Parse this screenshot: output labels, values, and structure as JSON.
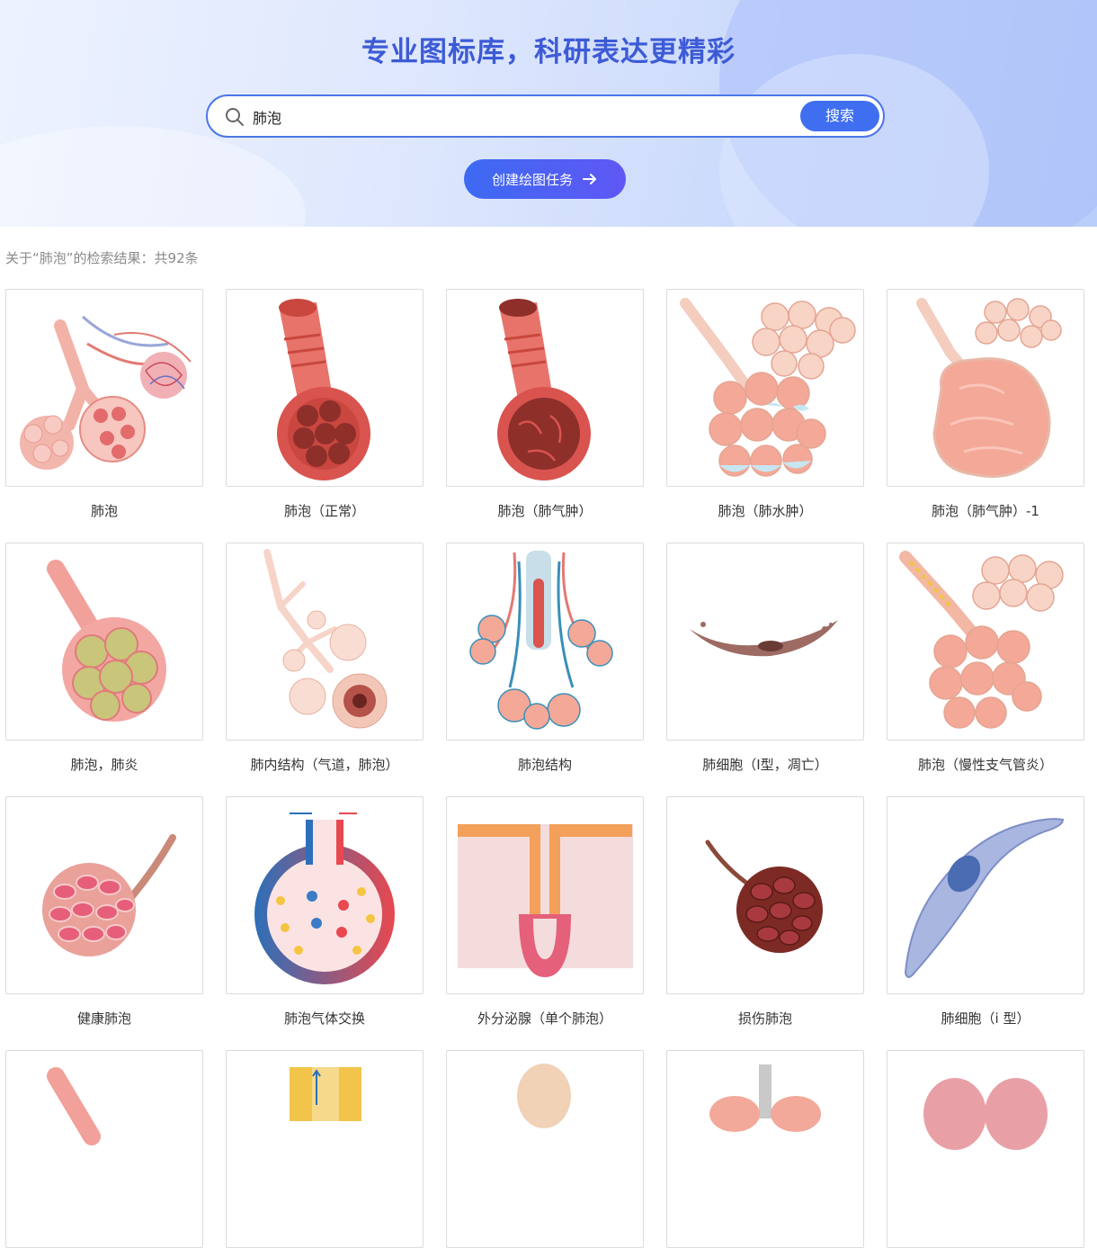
{
  "hero": {
    "title": "专业图标库，科研表达更精彩",
    "search": {
      "value": "肺泡",
      "button_label": "搜索"
    },
    "create_button": "创建绘图任务"
  },
  "results": {
    "summary": "关于“肺泡”的检索结果：共92条",
    "items": [
      {
        "label": "肺泡",
        "icon": "alveoli-branch-icon"
      },
      {
        "label": "肺泡（正常）",
        "icon": "alveolus-normal-icon"
      },
      {
        "label": "肺泡（肺气肿）",
        "icon": "alveolus-emphysema-icon"
      },
      {
        "label": "肺泡（肺水肿）",
        "icon": "alveolus-edema-icon"
      },
      {
        "label": "肺泡（肺气肿）-1",
        "icon": "alveolus-emphysema-1-icon"
      },
      {
        "label": "肺泡，肺炎",
        "icon": "alveolus-pneumonia-icon"
      },
      {
        "label": "肺内结构（气道，肺泡）",
        "icon": "lung-airway-structure-icon"
      },
      {
        "label": "肺泡结构",
        "icon": "alveolar-structure-icon"
      },
      {
        "label": "肺细胞（I型，凋亡）",
        "icon": "type1-cell-apoptosis-icon"
      },
      {
        "label": "肺泡（慢性支气管炎）",
        "icon": "alveolus-chronic-bronchitis-icon"
      },
      {
        "label": "健康肺泡",
        "icon": "healthy-alveolus-icon"
      },
      {
        "label": "肺泡气体交换",
        "icon": "alveolar-gas-exchange-icon"
      },
      {
        "label": "外分泌腺（单个肺泡）",
        "icon": "exocrine-gland-icon"
      },
      {
        "label": "损伤肺泡",
        "icon": "damaged-alveolus-icon"
      },
      {
        "label": "肺细胞（i 型）",
        "icon": "type1-pneumocyte-icon"
      },
      {
        "label": "",
        "icon": "alveolus-partial-icon"
      },
      {
        "label": "",
        "icon": "airway-section-partial-icon"
      },
      {
        "label": "",
        "icon": "human-head-partial-icon"
      },
      {
        "label": "",
        "icon": "trachea-lungs-partial-icon"
      },
      {
        "label": "",
        "icon": "lungs-partial-icon"
      }
    ]
  },
  "colors": {
    "brand": "#3f6ff0",
    "title": "#3d5bd6",
    "alveolus_pink": "#f0a597",
    "alveolus_red": "#d9534f"
  }
}
